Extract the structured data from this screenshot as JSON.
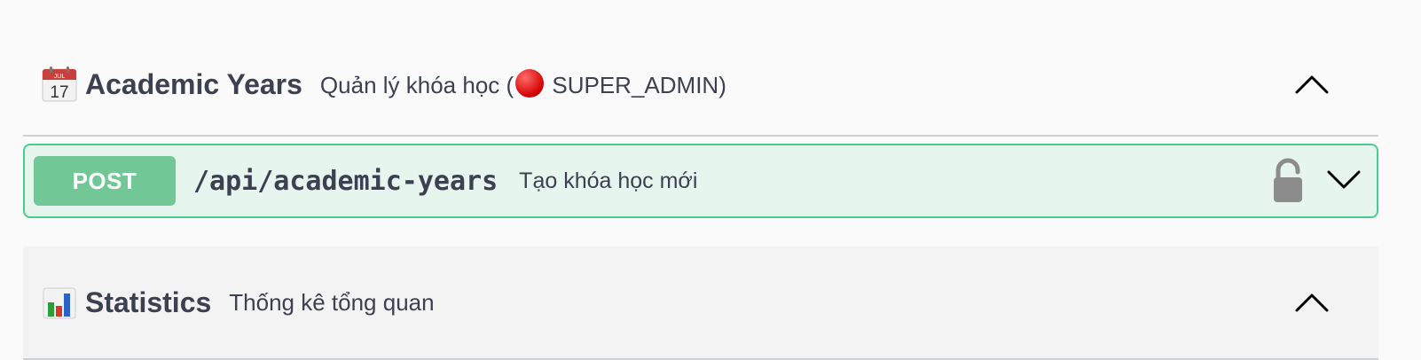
{
  "tags": [
    {
      "emoji": "calendar-icon",
      "calendar_month": "JUL",
      "calendar_day": "17",
      "title": "Academic Years",
      "description_prefix": "Quản lý khóa học (",
      "description_marker": "red-circle-icon",
      "description_suffix": " SUPER_ADMIN)",
      "expanded": true
    },
    {
      "emoji": "bar-chart-icon",
      "title": "Statistics",
      "description": "Thống kê tổng quan",
      "expanded": true
    }
  ],
  "operation": {
    "method": "POST",
    "path": "/api/academic-years",
    "summary": "Tạo khóa học mới",
    "method_color": "#49cc90",
    "lock_icon": "unlocked-lock-icon",
    "chevron_icon": "chevron-down-icon"
  },
  "colors": {
    "text": "#3b4151",
    "post_accent": "#49cc90",
    "background": "#fafafa"
  }
}
